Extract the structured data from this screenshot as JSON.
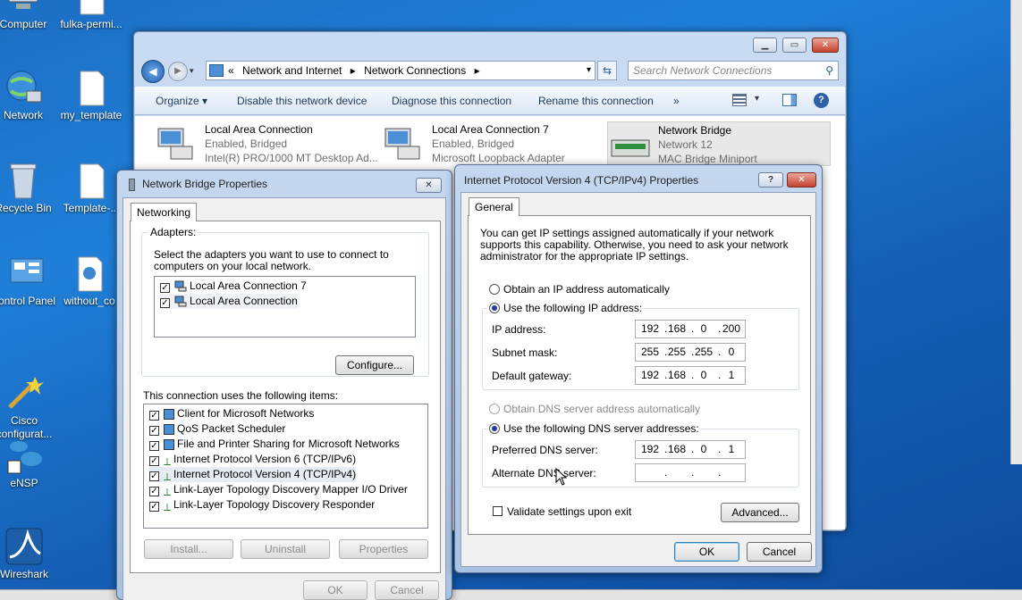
{
  "desktop": {
    "icons": [
      {
        "label": "Computer"
      },
      {
        "label": "fulka-permi..."
      },
      {
        "label": "Network"
      },
      {
        "label": "my_template"
      },
      {
        "label": "Recycle Bin"
      },
      {
        "label": "Template-..."
      },
      {
        "label": "ontrol Panel"
      },
      {
        "label": "without_co"
      },
      {
        "label": "Cisco\nconfigurat..."
      },
      {
        "label": "eNSP"
      },
      {
        "label": "Wireshark"
      }
    ]
  },
  "explorer": {
    "breadcrumb": [
      "Network and Internet",
      "Network Connections"
    ],
    "breadcrumb_sep": "«",
    "search_placeholder": "Search Network Connections",
    "commands": [
      "Organize",
      "Disable this network device",
      "Diagnose this connection",
      "Rename this connection",
      "»"
    ],
    "connections": [
      {
        "name": "Local Area Connection",
        "status": "Enabled, Bridged",
        "device": "Intel(R) PRO/1000 MT Desktop Ad..."
      },
      {
        "name": "Local Area Connection 7",
        "status": "Enabled, Bridged",
        "device": "Microsoft Loopback Adapter"
      },
      {
        "name": "Network Bridge",
        "status": "Network 12",
        "device": "MAC Bridge Miniport"
      }
    ]
  },
  "bridge_dialog": {
    "title": "Network Bridge Properties",
    "tab": "Networking",
    "adapters_label": "Adapters:",
    "adapters_desc": "Select the adapters you want to use to connect to computers on your local network.",
    "adapters": [
      {
        "name": "Local Area Connection 7",
        "checked": true
      },
      {
        "name": "Local Area Connection",
        "checked": true
      }
    ],
    "configure_label": "Configure...",
    "items_label": "This connection uses the following items:",
    "items": [
      {
        "name": "Client for Microsoft Networks",
        "checked": true
      },
      {
        "name": "QoS Packet Scheduler",
        "checked": true
      },
      {
        "name": "File and Printer Sharing for Microsoft Networks",
        "checked": true
      },
      {
        "name": "Internet Protocol Version 6 (TCP/IPv6)",
        "checked": true
      },
      {
        "name": "Internet Protocol Version 4 (TCP/IPv4)",
        "checked": true
      },
      {
        "name": "Link-Layer Topology Discovery Mapper I/O Driver",
        "checked": true
      },
      {
        "name": "Link-Layer Topology Discovery Responder",
        "checked": true
      }
    ],
    "install_label": "Install...",
    "uninstall_label": "Uninstall",
    "properties_label": "Properties",
    "ok_label": "OK",
    "cancel_label": "Cancel"
  },
  "ipv4_dialog": {
    "title": "Internet Protocol Version 4 (TCP/IPv4) Properties",
    "help_glyph": "?",
    "tab": "General",
    "intro": "You can get IP settings assigned automatically if your network supports this capability. Otherwise, you need to ask your network administrator for the appropriate IP settings.",
    "auto_ip_label": "Obtain an IP address automatically",
    "use_ip_label": "Use the following IP address:",
    "ip_label": "IP address:",
    "ip": [
      "192",
      "168",
      "0",
      "200"
    ],
    "subnet_label": "Subnet mask:",
    "subnet": [
      "255",
      "255",
      "255",
      "0"
    ],
    "gateway_label": "Default gateway:",
    "gateway": [
      "192",
      "168",
      "0",
      "1"
    ],
    "auto_dns_label": "Obtain DNS server address automatically",
    "use_dns_label": "Use the following DNS server addresses:",
    "pref_dns_label": "Preferred DNS server:",
    "pref_dns": [
      "192",
      "168",
      "0",
      "1"
    ],
    "alt_dns_label": "Alternate DNS server:",
    "validate_label": "Validate settings upon exit",
    "advanced_label": "Advanced...",
    "ok_label": "OK",
    "cancel_label": "Cancel"
  }
}
